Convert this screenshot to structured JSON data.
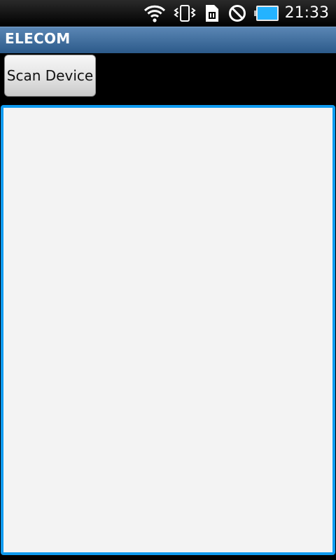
{
  "status_bar": {
    "time": "21:33",
    "icons": [
      "wifi-icon",
      "vibrate-icon",
      "sim-card-icon",
      "no-sign-icon",
      "battery-icon"
    ]
  },
  "app": {
    "title": "ELECOM"
  },
  "actions": {
    "scan_label": "Scan Device"
  },
  "device_list": {
    "items": []
  },
  "colors": {
    "title_bar": "#3d6c9c",
    "list_border": "#0f9bf0",
    "list_background": "#f3f3f3",
    "battery": "#24b3ff"
  }
}
